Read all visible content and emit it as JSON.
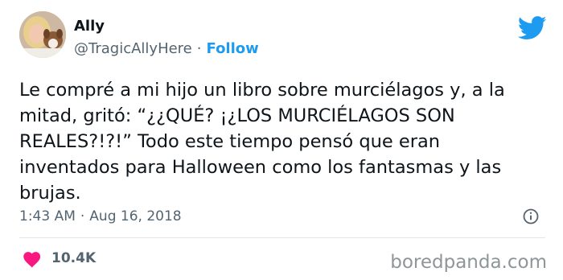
{
  "author": {
    "name": "Ally",
    "handle": "@TragicAllyHere",
    "separator": "·",
    "follow_label": "Follow"
  },
  "tweet": {
    "text": "Le compré a mi hijo un libro sobre murciélagos y, a la\nmitad, gritó: “¿¿QUÉ? ¡¿LOS MURCIÉLAGOS SON\nREALES?!?!” Todo este tiempo pensó que eran\ninventados para Halloween como los fantasmas y las\nbrujas.",
    "time": "1:43 AM",
    "separator": "·",
    "date": "Aug 16, 2018"
  },
  "engagement": {
    "likes": "10.4K"
  },
  "watermark": "boredpanda.com",
  "icons": {
    "platform": "twitter-bird-icon",
    "info": "info-icon",
    "like": "heart-icon"
  },
  "colors": {
    "accent": "#1d9bf0",
    "like": "#f91880",
    "muted": "#536471"
  }
}
